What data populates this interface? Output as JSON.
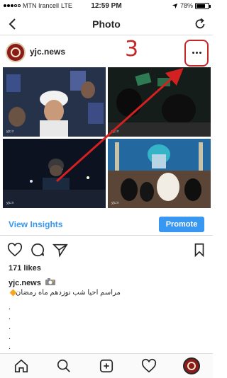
{
  "status_bar": {
    "carrier": "MTN Irancell",
    "network": "LTE",
    "time": "12:59 PM",
    "battery": "78%",
    "battery_level": 0.78
  },
  "nav": {
    "title": "Photo",
    "back_icon": "chevron-left-icon",
    "refresh_icon": "refresh-icon"
  },
  "post": {
    "username": "yjc.news",
    "annotation_number": "3",
    "more_icon": "more-horizontal-icon",
    "images": [
      {
        "label": "cleric-with-crowd-photo"
      },
      {
        "label": "night-prayer-photo"
      },
      {
        "label": "man-with-hat-photo"
      },
      {
        "label": "women-at-shrine-photo"
      }
    ],
    "watermark": "yjc.ir"
  },
  "insights": {
    "view_label": "View Insights",
    "promote_label": "Promote"
  },
  "actions": {
    "like_icon": "heart-icon",
    "comment_icon": "comment-icon",
    "share_icon": "send-icon",
    "save_icon": "bookmark-icon"
  },
  "likes_text": "171 likes",
  "caption": {
    "username": "yjc.news",
    "text": "مراسم احیا شب نوزدهم ماه رمضان",
    "dots": [
      ".",
      ".",
      ".",
      ".",
      "."
    ]
  },
  "tabbar": {
    "items": [
      "home-icon",
      "search-icon",
      "add-icon",
      "heart-icon",
      "profile-avatar"
    ]
  },
  "colors": {
    "accent": "#3897f0",
    "annotation": "#c62828"
  }
}
